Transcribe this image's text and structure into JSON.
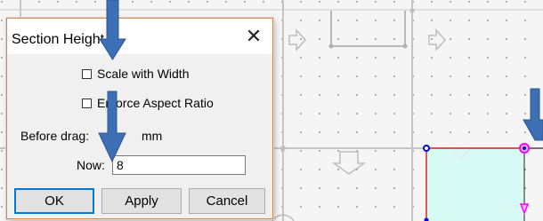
{
  "dialog": {
    "title": "Section Height",
    "close_glyph": "✕",
    "scale_with_width_label": "Scale with Width",
    "enforce_aspect_ratio_label": "Enforce Aspect Ratio",
    "before_drag_label": "Before drag:",
    "before_drag_value": "mm",
    "now_label": "Now:",
    "now_value": "8",
    "ok_label": "OK",
    "apply_label": "Apply",
    "cancel_label": "Cancel"
  },
  "colors": {
    "annotation_arrow": "#3c6fb4",
    "selection_outline": "#e0202a",
    "selection_fill": "#d7fbf4",
    "handle_magenta": "#ff00ff",
    "handle_blue": "#0000ff",
    "grid_line": "#c4c4c4"
  },
  "icons": {
    "close": "close-icon",
    "annotation": "down-arrow-icon",
    "canvas_arrow": "block-arrow-icon"
  }
}
